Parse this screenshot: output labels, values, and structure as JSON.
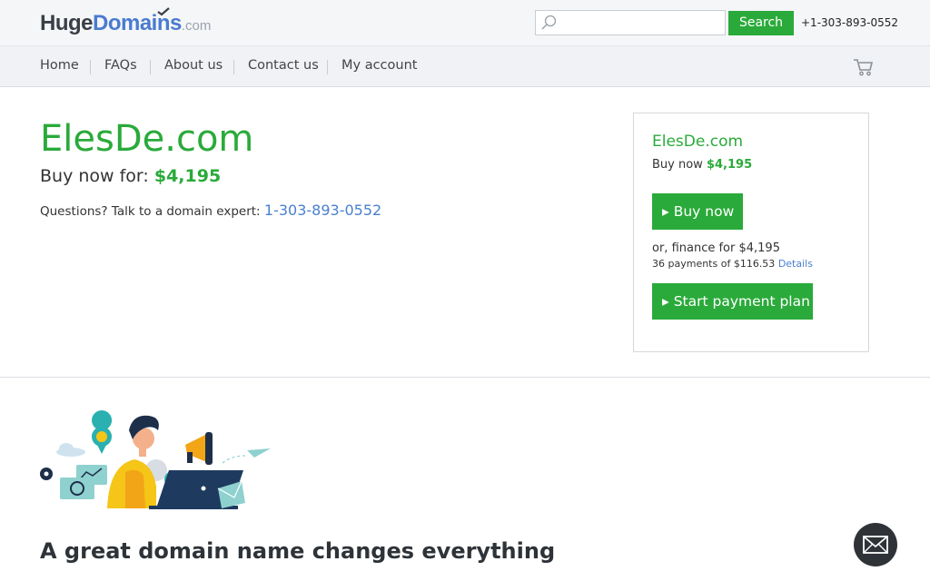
{
  "header": {
    "logo": {
      "huge": "Huge",
      "domains": "Domains",
      "com": ".com"
    },
    "search": {
      "placeholder": "",
      "value": "",
      "button_label": "Search"
    },
    "phone": "+1-303-893-0552"
  },
  "nav": {
    "items": [
      {
        "label": "Home"
      },
      {
        "label": "FAQs"
      },
      {
        "label": "About us"
      },
      {
        "label": "Contact us"
      },
      {
        "label": "My account"
      }
    ],
    "cart_icon": "cart-icon"
  },
  "hero": {
    "domain": "ElesDe.com",
    "buy_prefix": "Buy now for: ",
    "price": "$4,195",
    "questions_text": "Questions? Talk to a domain expert: ",
    "phone": "1-303-893-0552"
  },
  "card": {
    "domain": "ElesDe.com",
    "buy_prefix": "Buy now ",
    "price": "$4,195",
    "buy_button": "▸ Buy now",
    "finance_text": "or, finance for $4,195",
    "payments_text": "36 payments of $116.53 ",
    "details_link": "Details",
    "plan_button": "▸ Start payment plan"
  },
  "tagline": "A great domain name changes everything",
  "colors": {
    "accent": "#2aaa3a",
    "link": "#4a80d0",
    "logo_blue": "#4a7bd0",
    "chat_bg": "#2f3338"
  },
  "icons": [
    "search-icon",
    "cart-icon",
    "mail-icon",
    "checkmark-icon"
  ]
}
